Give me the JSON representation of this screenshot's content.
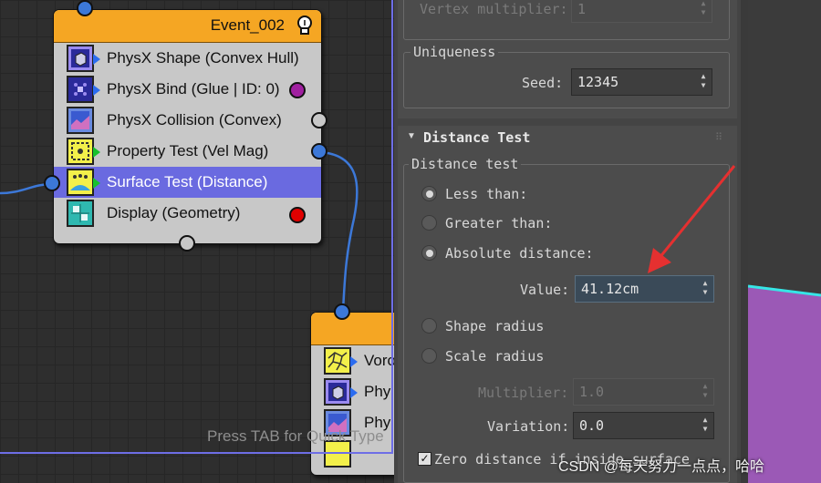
{
  "event_top": {
    "title": "Event_002",
    "operators": [
      {
        "label": "PhysX Shape (Convex Hull)",
        "icon": "cube-icon"
      },
      {
        "label": "PhysX Bind (Glue | ID: 0)",
        "icon": "glue-icon"
      },
      {
        "label": "PhysX Collision (Convex)",
        "icon": "collision-icon"
      },
      {
        "label": "Property Test (Vel Mag)",
        "icon": "property-test-icon"
      },
      {
        "label": "Surface Test (Distance)",
        "icon": "surface-test-icon"
      },
      {
        "label": "Display (Geometry)",
        "icon": "display-icon"
      }
    ]
  },
  "event_bottom": {
    "operators": [
      {
        "label": "Voro",
        "icon": "voronoi-icon"
      },
      {
        "label": "Phy",
        "icon": "cube-icon"
      },
      {
        "label": "Phy",
        "icon": "collision-icon"
      }
    ]
  },
  "graph": {
    "hint": "Press TAB for Quick Type"
  },
  "panel": {
    "vertex_multiplier_label": "Vertex multiplier:",
    "vertex_multiplier_value": "1",
    "uniqueness_group": "Uniqueness",
    "seed_label": "Seed:",
    "seed_value": "12345",
    "rollout_title": "Distance Test",
    "distance_group": "Distance test",
    "less_than": "Less than:",
    "greater_than": "Greater than:",
    "absolute_distance": "Absolute distance:",
    "value_label": "Value:",
    "value_value": "41.12cm",
    "shape_radius": "Shape radius",
    "scale_radius": "Scale radius",
    "multiplier_label": "Multiplier:",
    "multiplier_value": "1.0",
    "variation_label": "Variation:",
    "variation_value": "0.0",
    "zero_distance": "Zero distance if inside surface"
  },
  "watermark": "CSDN @每天努力一点点，哈哈",
  "colors": {
    "event_header": "#f5a623",
    "selection": "#6a6ae0",
    "wire": "#3c78d8",
    "annotation_arrow": "#e53030",
    "mesh": "#9b59b6"
  }
}
